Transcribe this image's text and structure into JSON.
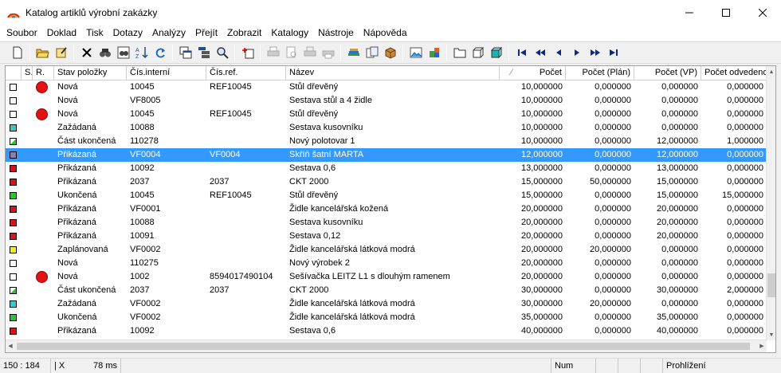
{
  "window": {
    "title": "Katalog artiklů výrobní zakázky",
    "app_icon": "rainbow-logo-icon",
    "controls": [
      "minimize-icon",
      "maximize-icon",
      "close-icon"
    ]
  },
  "menu": [
    {
      "label": "Soubor"
    },
    {
      "label": "Doklad"
    },
    {
      "label": "Tisk"
    },
    {
      "label": "Dotazy"
    },
    {
      "label": "Analýzy"
    },
    {
      "label": "Přejít"
    },
    {
      "label": "Zobrazit"
    },
    {
      "label": "Katalogy"
    },
    {
      "label": "Nástroje"
    },
    {
      "label": "Nápověda"
    }
  ],
  "toolbar": {
    "groups": [
      [
        "new-document-icon"
      ],
      [
        "open-folder-icon",
        "edit-document-icon"
      ],
      [
        "delete-icon",
        "find-icon",
        "find-column-icon",
        "sort-icon",
        "refresh-icon"
      ],
      [
        "copy-window-icon",
        "tree-view-icon",
        "zoom-icon",
        "insert-icon"
      ],
      [
        "print-icon",
        "print-preview-icon",
        "print-disabled-icon",
        "print-setup-icon"
      ],
      [
        "books-icon",
        "documents-icon",
        "package-icon"
      ],
      [
        "gallery-icon",
        "puzzle-icon"
      ],
      [
        "folder-icon",
        "cube-white-icon",
        "cube-teal-icon"
      ],
      [
        "first-record-icon",
        "prev-page-icon",
        "prev-record-icon",
        "next-record-icon",
        "next-page-icon",
        "last-record-icon"
      ]
    ]
  },
  "grid": {
    "columns": [
      {
        "key": "chk",
        "label": ""
      },
      {
        "key": "s",
        "label": "S."
      },
      {
        "key": "r",
        "label": "R."
      },
      {
        "key": "stav",
        "label": "Stav položky"
      },
      {
        "key": "int",
        "label": "Čís.interní"
      },
      {
        "key": "ref",
        "label": "Čís.ref."
      },
      {
        "key": "naz",
        "label": "Název"
      },
      {
        "key": "poc",
        "label": "Počet"
      },
      {
        "key": "plan",
        "label": "Počet (Plán)"
      },
      {
        "key": "vp",
        "label": "Počet (VP)"
      },
      {
        "key": "odv",
        "label": "Počet odvedeno"
      }
    ],
    "sorted_column": "poc",
    "rows": [
      {
        "status_color": "#ffffff",
        "marker": "red-dot",
        "stav": "Nová",
        "int": "10045",
        "ref": "REF10045",
        "naz": "Stůl dřevěný",
        "poc": "10,000000",
        "plan": "0,000000",
        "vp": "0,000000",
        "odv": "0,000000"
      },
      {
        "status_color": "#ffffff",
        "marker": "",
        "stav": "Nová",
        "int": "VF8005",
        "ref": "",
        "naz": "Sestava stůl a 4 židle",
        "poc": "10,000000",
        "plan": "0,000000",
        "vp": "0,000000",
        "odv": "0,000000"
      },
      {
        "status_color": "#ffffff",
        "marker": "red-dot",
        "stav": "Nová",
        "int": "10045",
        "ref": "REF10045",
        "naz": "Stůl dřevěný",
        "poc": "10,000000",
        "plan": "0,000000",
        "vp": "0,000000",
        "odv": "0,000000"
      },
      {
        "status_color": "#33cccc",
        "marker": "",
        "stav": "Zažádaná",
        "int": "10088",
        "ref": "",
        "naz": "Sestava kusovníku",
        "poc": "10,000000",
        "plan": "0,000000",
        "vp": "0,000000",
        "odv": "0,000000"
      },
      {
        "status_color": "half-green",
        "marker": "",
        "stav": "Část ukončená",
        "int": "110278",
        "ref": "",
        "naz": "Nový polotovar 1",
        "poc": "10,000000",
        "plan": "0,000000",
        "vp": "12,000000",
        "odv": "1,000000"
      },
      {
        "status_color": "#8080c0",
        "marker": "",
        "stav": "Přikázaná",
        "int": "VF0004",
        "ref": "VF0004",
        "naz": "Skříň šatní MARTA",
        "poc": "12,000000",
        "plan": "0,000000",
        "vp": "12,000000",
        "odv": "0,000000",
        "selected": true
      },
      {
        "status_color": "#e01010",
        "marker": "",
        "stav": "Přikázaná",
        "int": "10092",
        "ref": "",
        "naz": "Sestava 0,6",
        "poc": "13,000000",
        "plan": "0,000000",
        "vp": "13,000000",
        "odv": "0,000000"
      },
      {
        "status_color": "#e01010",
        "marker": "",
        "stav": "Přikázaná",
        "int": "2037",
        "ref": "2037",
        "naz": "CKT 2000",
        "poc": "15,000000",
        "plan": "50,000000",
        "vp": "15,000000",
        "odv": "0,000000"
      },
      {
        "status_color": "#22cc22",
        "marker": "",
        "stav": "Ukončená",
        "int": "10045",
        "ref": "REF10045",
        "naz": "Stůl dřevěný",
        "poc": "15,000000",
        "plan": "0,000000",
        "vp": "15,000000",
        "odv": "15,000000"
      },
      {
        "status_color": "#e01010",
        "marker": "",
        "stav": "Přikázaná",
        "int": "VF0001",
        "ref": "",
        "naz": "Židle kancelářská kožená",
        "poc": "20,000000",
        "plan": "0,000000",
        "vp": "20,000000",
        "odv": "0,000000"
      },
      {
        "status_color": "#e01010",
        "marker": "",
        "stav": "Přikázaná",
        "int": "10088",
        "ref": "",
        "naz": "Sestava kusovníku",
        "poc": "20,000000",
        "plan": "0,000000",
        "vp": "20,000000",
        "odv": "0,000000"
      },
      {
        "status_color": "#e01010",
        "marker": "",
        "stav": "Přikázaná",
        "int": "10091",
        "ref": "",
        "naz": "Sestava 0,12",
        "poc": "20,000000",
        "plan": "0,000000",
        "vp": "20,000000",
        "odv": "0,000000"
      },
      {
        "status_color": "#eeee22",
        "marker": "",
        "stav": "Zaplánovaná",
        "int": "VF0002",
        "ref": "",
        "naz": "Židle kancelářská látková modrá",
        "poc": "20,000000",
        "plan": "20,000000",
        "vp": "0,000000",
        "odv": "0,000000"
      },
      {
        "status_color": "#ffffff",
        "marker": "",
        "stav": "Nová",
        "int": "110275",
        "ref": "",
        "naz": "Nový výrobek 2",
        "poc": "20,000000",
        "plan": "0,000000",
        "vp": "0,000000",
        "odv": "0,000000"
      },
      {
        "status_color": "#ffffff",
        "marker": "red-dot",
        "stav": "Nová",
        "int": "1002",
        "ref": "8594017490104",
        "naz": "Sešívačka LEITZ L1 s dlouhým ramenem",
        "poc": "20,000000",
        "plan": "0,000000",
        "vp": "0,000000",
        "odv": "0,000000"
      },
      {
        "status_color": "half-green",
        "marker": "",
        "stav": "Část ukončená",
        "int": "2037",
        "ref": "2037",
        "naz": "CKT 2000",
        "poc": "30,000000",
        "plan": "0,000000",
        "vp": "30,000000",
        "odv": "2,000000"
      },
      {
        "status_color": "#33cccc",
        "marker": "",
        "stav": "Zažádaná",
        "int": "VF0002",
        "ref": "",
        "naz": "Židle kancelářská látková modrá",
        "poc": "30,000000",
        "plan": "20,000000",
        "vp": "0,000000",
        "odv": "0,000000"
      },
      {
        "status_color": "#22cc22",
        "marker": "",
        "stav": "Ukončená",
        "int": "VF0002",
        "ref": "",
        "naz": "Židle kancelářská látková modrá",
        "poc": "35,000000",
        "plan": "0,000000",
        "vp": "35,000000",
        "odv": "0,000000"
      },
      {
        "status_color": "#e01010",
        "marker": "",
        "stav": "Přikázaná",
        "int": "10092",
        "ref": "",
        "naz": "Sestava 0,6",
        "poc": "40,000000",
        "plan": "0,000000",
        "vp": "40,000000",
        "odv": "0,000000"
      }
    ]
  },
  "statusbar": {
    "position": "150 :   184",
    "mode": "| X",
    "timing": "78 ms",
    "num": "Num",
    "view": "Prohlížení"
  },
  "colors": {
    "selection": "#3399ff",
    "marker_red": "#e21212"
  }
}
